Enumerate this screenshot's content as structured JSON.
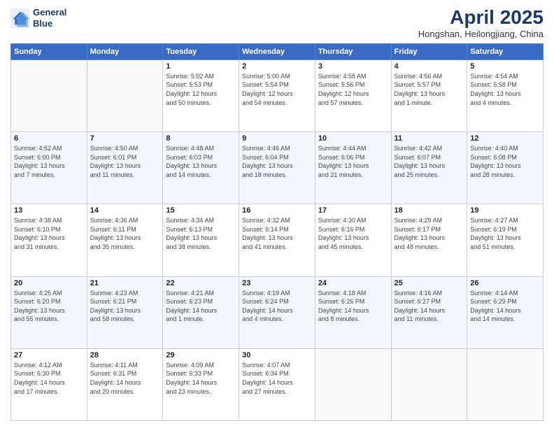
{
  "header": {
    "logo_line1": "General",
    "logo_line2": "Blue",
    "month": "April 2025",
    "location": "Hongshan, Heilongjiang, China"
  },
  "days_of_week": [
    "Sunday",
    "Monday",
    "Tuesday",
    "Wednesday",
    "Thursday",
    "Friday",
    "Saturday"
  ],
  "weeks": [
    [
      {
        "day": "",
        "info": ""
      },
      {
        "day": "",
        "info": ""
      },
      {
        "day": "1",
        "info": "Sunrise: 5:02 AM\nSunset: 5:53 PM\nDaylight: 12 hours\nand 50 minutes."
      },
      {
        "day": "2",
        "info": "Sunrise: 5:00 AM\nSunset: 5:54 PM\nDaylight: 12 hours\nand 54 minutes."
      },
      {
        "day": "3",
        "info": "Sunrise: 4:58 AM\nSunset: 5:56 PM\nDaylight: 12 hours\nand 57 minutes."
      },
      {
        "day": "4",
        "info": "Sunrise: 4:56 AM\nSunset: 5:57 PM\nDaylight: 13 hours\nand 1 minute."
      },
      {
        "day": "5",
        "info": "Sunrise: 4:54 AM\nSunset: 5:58 PM\nDaylight: 13 hours\nand 4 minutes."
      }
    ],
    [
      {
        "day": "6",
        "info": "Sunrise: 4:52 AM\nSunset: 6:00 PM\nDaylight: 13 hours\nand 7 minutes."
      },
      {
        "day": "7",
        "info": "Sunrise: 4:50 AM\nSunset: 6:01 PM\nDaylight: 13 hours\nand 11 minutes."
      },
      {
        "day": "8",
        "info": "Sunrise: 4:48 AM\nSunset: 6:03 PM\nDaylight: 13 hours\nand 14 minutes."
      },
      {
        "day": "9",
        "info": "Sunrise: 4:46 AM\nSunset: 6:04 PM\nDaylight: 13 hours\nand 18 minutes."
      },
      {
        "day": "10",
        "info": "Sunrise: 4:44 AM\nSunset: 6:06 PM\nDaylight: 13 hours\nand 21 minutes."
      },
      {
        "day": "11",
        "info": "Sunrise: 4:42 AM\nSunset: 6:07 PM\nDaylight: 13 hours\nand 25 minutes."
      },
      {
        "day": "12",
        "info": "Sunrise: 4:40 AM\nSunset: 6:08 PM\nDaylight: 13 hours\nand 28 minutes."
      }
    ],
    [
      {
        "day": "13",
        "info": "Sunrise: 4:38 AM\nSunset: 6:10 PM\nDaylight: 13 hours\nand 31 minutes."
      },
      {
        "day": "14",
        "info": "Sunrise: 4:36 AM\nSunset: 6:11 PM\nDaylight: 13 hours\nand 35 minutes."
      },
      {
        "day": "15",
        "info": "Sunrise: 4:34 AM\nSunset: 6:13 PM\nDaylight: 13 hours\nand 38 minutes."
      },
      {
        "day": "16",
        "info": "Sunrise: 4:32 AM\nSunset: 6:14 PM\nDaylight: 13 hours\nand 41 minutes."
      },
      {
        "day": "17",
        "info": "Sunrise: 4:30 AM\nSunset: 6:16 PM\nDaylight: 13 hours\nand 45 minutes."
      },
      {
        "day": "18",
        "info": "Sunrise: 4:29 AM\nSunset: 6:17 PM\nDaylight: 13 hours\nand 48 minutes."
      },
      {
        "day": "19",
        "info": "Sunrise: 4:27 AM\nSunset: 6:19 PM\nDaylight: 13 hours\nand 51 minutes."
      }
    ],
    [
      {
        "day": "20",
        "info": "Sunrise: 4:25 AM\nSunset: 6:20 PM\nDaylight: 13 hours\nand 55 minutes."
      },
      {
        "day": "21",
        "info": "Sunrise: 4:23 AM\nSunset: 6:21 PM\nDaylight: 13 hours\nand 58 minutes."
      },
      {
        "day": "22",
        "info": "Sunrise: 4:21 AM\nSunset: 6:23 PM\nDaylight: 14 hours\nand 1 minute."
      },
      {
        "day": "23",
        "info": "Sunrise: 4:19 AM\nSunset: 6:24 PM\nDaylight: 14 hours\nand 4 minutes."
      },
      {
        "day": "24",
        "info": "Sunrise: 4:18 AM\nSunset: 6:26 PM\nDaylight: 14 hours\nand 8 minutes."
      },
      {
        "day": "25",
        "info": "Sunrise: 4:16 AM\nSunset: 6:27 PM\nDaylight: 14 hours\nand 11 minutes."
      },
      {
        "day": "26",
        "info": "Sunrise: 4:14 AM\nSunset: 6:29 PM\nDaylight: 14 hours\nand 14 minutes."
      }
    ],
    [
      {
        "day": "27",
        "info": "Sunrise: 4:12 AM\nSunset: 6:30 PM\nDaylight: 14 hours\nand 17 minutes."
      },
      {
        "day": "28",
        "info": "Sunrise: 4:11 AM\nSunset: 6:31 PM\nDaylight: 14 hours\nand 20 minutes."
      },
      {
        "day": "29",
        "info": "Sunrise: 4:09 AM\nSunset: 6:33 PM\nDaylight: 14 hours\nand 23 minutes."
      },
      {
        "day": "30",
        "info": "Sunrise: 4:07 AM\nSunset: 6:34 PM\nDaylight: 14 hours\nand 27 minutes."
      },
      {
        "day": "",
        "info": ""
      },
      {
        "day": "",
        "info": ""
      },
      {
        "day": "",
        "info": ""
      }
    ]
  ]
}
